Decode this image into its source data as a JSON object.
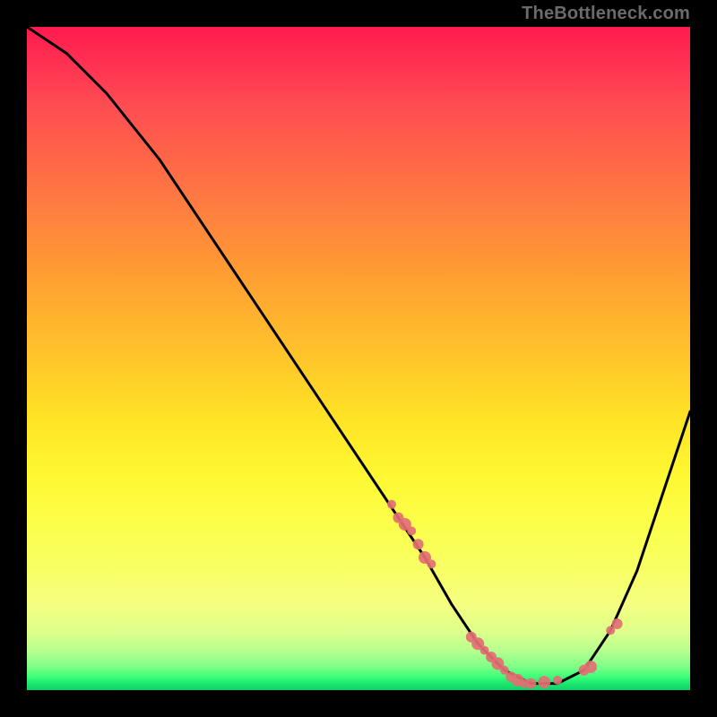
{
  "watermark": "TheBottleneck.com",
  "chart_data": {
    "type": "line",
    "title": "",
    "xlabel": "",
    "ylabel": "",
    "xlim": [
      0,
      100
    ],
    "ylim": [
      0,
      100
    ],
    "series": [
      {
        "name": "bottleneck-curve",
        "x": [
          0,
          6,
          12,
          20,
          28,
          36,
          44,
          50,
          56,
          60,
          64,
          68,
          72,
          76,
          80,
          84,
          88,
          92,
          96,
          100
        ],
        "y": [
          100,
          96,
          90,
          80,
          68,
          56,
          44,
          35,
          26,
          20,
          13,
          7,
          3,
          1,
          1,
          3,
          9,
          18,
          30,
          42
        ]
      }
    ],
    "scatter": {
      "name": "highlighted-points",
      "x": [
        55,
        56,
        57,
        58,
        59,
        60,
        61,
        67,
        68,
        69,
        70,
        71,
        72,
        73,
        74,
        75,
        76,
        78,
        80,
        84,
        85,
        88,
        89
      ],
      "y": [
        28,
        26,
        25,
        24,
        22,
        20,
        19,
        8,
        7,
        6,
        5,
        4,
        3,
        2,
        1.5,
        1,
        1,
        1.2,
        1.5,
        3,
        3.5,
        9,
        10
      ]
    },
    "colors": {
      "curve": "#000000",
      "scatter": "#e36f74",
      "gradient_top": "#ff1a4d",
      "gradient_bottom": "#12d166"
    }
  }
}
